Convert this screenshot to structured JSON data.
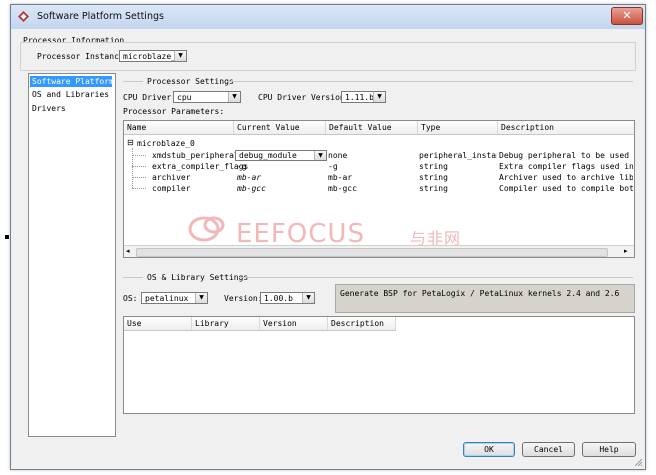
{
  "window": {
    "title": "Software Platform Settings",
    "close_glyph": "✕"
  },
  "processor_info": {
    "legend": "Processor Information",
    "instance_label": "Processor Instance:",
    "instance_value": "microblaze_0"
  },
  "sidebar": {
    "items": [
      {
        "label": "Software Platform",
        "selected": true
      },
      {
        "label": "OS and Libraries",
        "selected": false
      },
      {
        "label": "Drivers",
        "selected": false
      }
    ]
  },
  "processor_settings": {
    "legend": "Processor Settings",
    "cpu_driver_label": "CPU Driver:",
    "cpu_driver_value": "cpu",
    "cpu_version_label": "CPU Driver Version:",
    "cpu_version_value": "1.11.b",
    "params_label": "Processor Parameters:"
  },
  "params_table": {
    "columns": [
      "Name",
      "Current Value",
      "Default Value",
      "Type",
      "Description"
    ],
    "group": {
      "expander": "⊟",
      "name": "microblaze_0"
    },
    "rows": [
      {
        "name": "xmdstub_peripheral",
        "current": "debug_module",
        "default": "none",
        "type": "peripheral_instance",
        "description": "Debug peripheral to be used with x"
      },
      {
        "name": "extra_compiler_flags",
        "current": "-g",
        "default": "-g",
        "type": "string",
        "description": "Extra compiler flags used in BSP"
      },
      {
        "name": "archiver",
        "current": "mb-ar",
        "default": "mb-ar",
        "type": "string",
        "description": "Archiver used to archive librarie"
      },
      {
        "name": "compiler",
        "current": "mb-gcc",
        "default": "mb-gcc",
        "type": "string",
        "description": "Compiler used to compile both BSP"
      }
    ]
  },
  "os_settings": {
    "legend": "OS & Library Settings",
    "os_label": "OS:",
    "os_value": "petalinux",
    "version_label": "Version:",
    "version_value": "1.00.b",
    "description": "Generate BSP for PetaLogix / PetaLinux kernels 2.4 and 2.6"
  },
  "library_table": {
    "columns": [
      "Use",
      "Library",
      "Version",
      "Description"
    ]
  },
  "buttons": {
    "ok": "OK",
    "cancel": "Cancel",
    "help": "Help"
  },
  "watermark": {
    "brand": "EEFOCUS",
    "chinese": "与非网"
  },
  "colors": {
    "selection": "#3399ff",
    "titlebar": "#c9d9ef",
    "close_button": "#c9523f"
  }
}
